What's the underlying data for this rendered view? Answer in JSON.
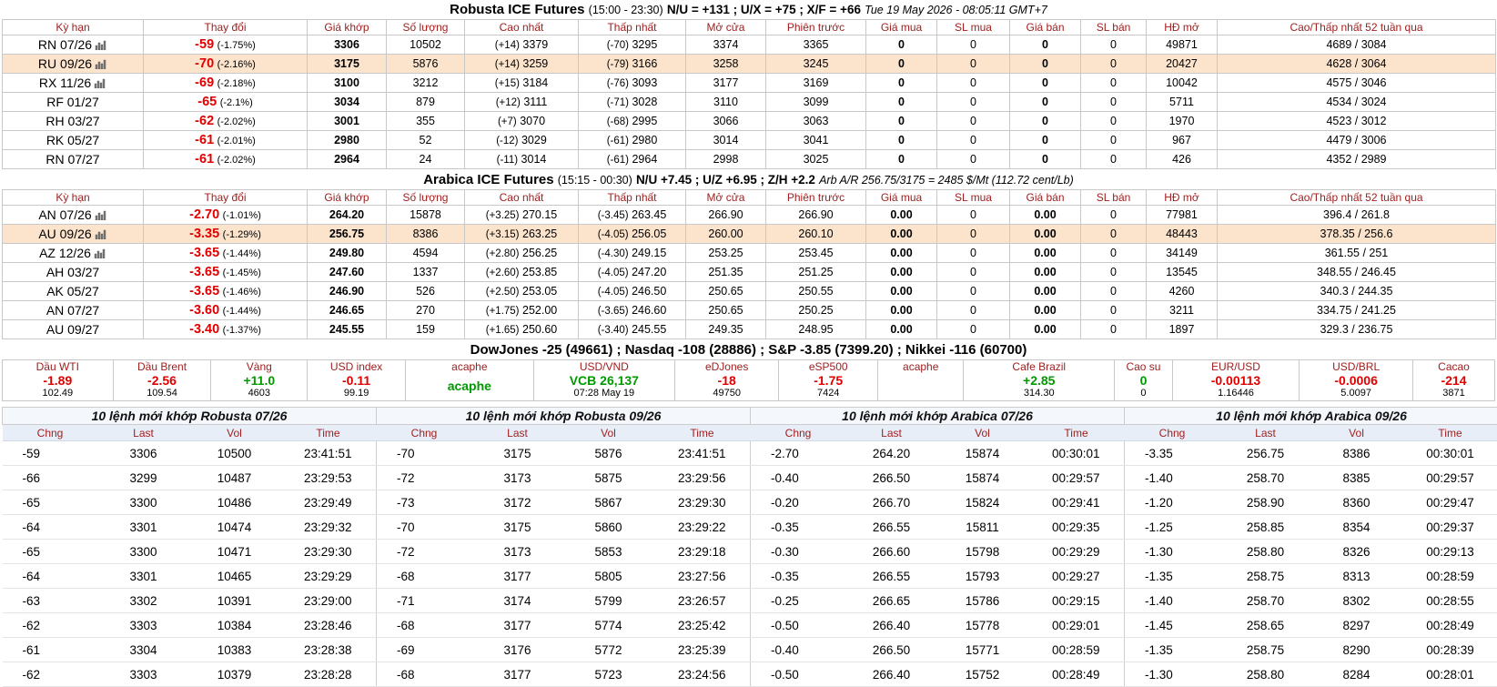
{
  "robusta": {
    "title": "Robusta ICE Futures",
    "hours": "(15:00 - 23:30)",
    "spreads": "N/U = +131 ; U/X = +75 ; X/F = +66",
    "timestamp": "Tue 19 May 2026 - 08:05:11 GMT+7",
    "headers": [
      "Kỳ hạn",
      "Thay đổi",
      "Giá khớp",
      "Số lượng",
      "Cao nhất",
      "Thấp nhất",
      "Mở cửa",
      "Phiên trước",
      "Giá mua",
      "SL mua",
      "Giá bán",
      "SL bán",
      "HĐ mở",
      "Cao/Thấp nhất 52 tuần qua"
    ],
    "rows": [
      {
        "sym": "RN 07/26",
        "chart": true,
        "hl": false,
        "chg": "-59",
        "pct": "(-1.75%)",
        "last": "3306",
        "vol": "10502",
        "high_d": "(+14)",
        "high": "3379",
        "low_d": "(-70)",
        "low": "3295",
        "open": "3374",
        "prev": "3365",
        "bid": "0",
        "bidq": "0",
        "ask": "0",
        "askq": "0",
        "oi": "49871",
        "range": "4689 / 3084"
      },
      {
        "sym": "RU 09/26",
        "chart": true,
        "hl": true,
        "chg": "-70",
        "pct": "(-2.16%)",
        "last": "3175",
        "vol": "5876",
        "high_d": "(+14)",
        "high": "3259",
        "low_d": "(-79)",
        "low": "3166",
        "open": "3258",
        "prev": "3245",
        "bid": "0",
        "bidq": "0",
        "ask": "0",
        "askq": "0",
        "oi": "20427",
        "range": "4628 / 3064"
      },
      {
        "sym": "RX 11/26",
        "chart": true,
        "hl": false,
        "chg": "-69",
        "pct": "(-2.18%)",
        "last": "3100",
        "vol": "3212",
        "high_d": "(+15)",
        "high": "3184",
        "low_d": "(-76)",
        "low": "3093",
        "open": "3177",
        "prev": "3169",
        "bid": "0",
        "bidq": "0",
        "ask": "0",
        "askq": "0",
        "oi": "10042",
        "range": "4575 / 3046"
      },
      {
        "sym": "RF 01/27",
        "chart": false,
        "hl": false,
        "chg": "-65",
        "pct": "(-2.1%)",
        "last": "3034",
        "vol": "879",
        "high_d": "(+12)",
        "high": "3111",
        "low_d": "(-71)",
        "low": "3028",
        "open": "3110",
        "prev": "3099",
        "bid": "0",
        "bidq": "0",
        "ask": "0",
        "askq": "0",
        "oi": "5711",
        "range": "4534 / 3024"
      },
      {
        "sym": "RH 03/27",
        "chart": false,
        "hl": false,
        "chg": "-62",
        "pct": "(-2.02%)",
        "last": "3001",
        "vol": "355",
        "high_d": "(+7)",
        "high": "3070",
        "low_d": "(-68)",
        "low": "2995",
        "open": "3066",
        "prev": "3063",
        "bid": "0",
        "bidq": "0",
        "ask": "0",
        "askq": "0",
        "oi": "1970",
        "range": "4523 / 3012"
      },
      {
        "sym": "RK 05/27",
        "chart": false,
        "hl": false,
        "chg": "-61",
        "pct": "(-2.01%)",
        "last": "2980",
        "vol": "52",
        "high_d": "(-12)",
        "high": "3029",
        "low_d": "(-61)",
        "low": "2980",
        "open": "3014",
        "prev": "3041",
        "bid": "0",
        "bidq": "0",
        "ask": "0",
        "askq": "0",
        "oi": "967",
        "range": "4479 / 3006"
      },
      {
        "sym": "RN 07/27",
        "chart": false,
        "hl": false,
        "chg": "-61",
        "pct": "(-2.02%)",
        "last": "2964",
        "vol": "24",
        "high_d": "(-11)",
        "high": "3014",
        "low_d": "(-61)",
        "low": "2964",
        "open": "2998",
        "prev": "3025",
        "bid": "0",
        "bidq": "0",
        "ask": "0",
        "askq": "0",
        "oi": "426",
        "range": "4352 / 2989"
      }
    ]
  },
  "arabica": {
    "title": "Arabica ICE Futures",
    "hours": "(15:15 - 00:30)",
    "spreads": "N/U +7.45 ; U/Z +6.95 ; Z/H +2.2",
    "arb": "Arb A/R 256.75/3175 = 2485 $/Mt (112.72 cent/Lb)",
    "headers": [
      "Kỳ hạn",
      "Thay đổi",
      "Giá khớp",
      "Số lượng",
      "Cao nhất",
      "Thấp nhất",
      "Mở cửa",
      "Phiên trước",
      "Giá mua",
      "SL mua",
      "Giá bán",
      "SL bán",
      "HĐ mở",
      "Cao/Thấp nhất 52 tuần qua"
    ],
    "rows": [
      {
        "sym": "AN 07/26",
        "chart": true,
        "hl": false,
        "chg": "-2.70",
        "pct": "(-1.01%)",
        "last": "264.20",
        "vol": "15878",
        "high_d": "(+3.25)",
        "high": "270.15",
        "low_d": "(-3.45)",
        "low": "263.45",
        "open": "266.90",
        "prev": "266.90",
        "bid": "0.00",
        "bidq": "0",
        "ask": "0.00",
        "askq": "0",
        "oi": "77981",
        "range": "396.4 / 261.8"
      },
      {
        "sym": "AU 09/26",
        "chart": true,
        "hl": true,
        "chg": "-3.35",
        "pct": "(-1.29%)",
        "last": "256.75",
        "vol": "8386",
        "high_d": "(+3.15)",
        "high": "263.25",
        "low_d": "(-4.05)",
        "low": "256.05",
        "open": "260.00",
        "prev": "260.10",
        "bid": "0.00",
        "bidq": "0",
        "ask": "0.00",
        "askq": "0",
        "oi": "48443",
        "range": "378.35 / 256.6"
      },
      {
        "sym": "AZ 12/26",
        "chart": true,
        "hl": false,
        "chg": "-3.65",
        "pct": "(-1.44%)",
        "last": "249.80",
        "vol": "4594",
        "high_d": "(+2.80)",
        "high": "256.25",
        "low_d": "(-4.30)",
        "low": "249.15",
        "open": "253.25",
        "prev": "253.45",
        "bid": "0.00",
        "bidq": "0",
        "ask": "0.00",
        "askq": "0",
        "oi": "34149",
        "range": "361.55 / 251"
      },
      {
        "sym": "AH 03/27",
        "chart": false,
        "hl": false,
        "chg": "-3.65",
        "pct": "(-1.45%)",
        "last": "247.60",
        "vol": "1337",
        "high_d": "(+2.60)",
        "high": "253.85",
        "low_d": "(-4.05)",
        "low": "247.20",
        "open": "251.35",
        "prev": "251.25",
        "bid": "0.00",
        "bidq": "0",
        "ask": "0.00",
        "askq": "0",
        "oi": "13545",
        "range": "348.55 / 246.45"
      },
      {
        "sym": "AK 05/27",
        "chart": false,
        "hl": false,
        "chg": "-3.65",
        "pct": "(-1.46%)",
        "last": "246.90",
        "vol": "526",
        "high_d": "(+2.50)",
        "high": "253.05",
        "low_d": "(-4.05)",
        "low": "246.50",
        "open": "250.65",
        "prev": "250.55",
        "bid": "0.00",
        "bidq": "0",
        "ask": "0.00",
        "askq": "0",
        "oi": "4260",
        "range": "340.3 / 244.35"
      },
      {
        "sym": "AN 07/27",
        "chart": false,
        "hl": false,
        "chg": "-3.60",
        "pct": "(-1.44%)",
        "last": "246.65",
        "vol": "270",
        "high_d": "(+1.75)",
        "high": "252.00",
        "low_d": "(-3.65)",
        "low": "246.60",
        "open": "250.65",
        "prev": "250.25",
        "bid": "0.00",
        "bidq": "0",
        "ask": "0.00",
        "askq": "0",
        "oi": "3211",
        "range": "334.75 / 241.25"
      },
      {
        "sym": "AU 09/27",
        "chart": false,
        "hl": false,
        "chg": "-3.40",
        "pct": "(-1.37%)",
        "last": "245.55",
        "vol": "159",
        "high_d": "(+1.65)",
        "high": "250.60",
        "low_d": "(-3.40)",
        "low": "245.55",
        "open": "249.35",
        "prev": "248.95",
        "bid": "0.00",
        "bidq": "0",
        "ask": "0.00",
        "askq": "0",
        "oi": "1897",
        "range": "329.3 / 236.75"
      }
    ]
  },
  "indices_line": "DowJones -25 (49661) ; Nasdaq -108 (28886) ; S&P -3.85 (7399.20) ; Nikkei -116 (60700)",
  "markets": [
    {
      "label": "Dầu WTI",
      "value": "-1.89",
      "sub": "102.49",
      "color": "red"
    },
    {
      "label": "Dầu Brent",
      "value": "-2.56",
      "sub": "109.54",
      "color": "red"
    },
    {
      "label": "Vàng",
      "value": "+11.0",
      "sub": "4603",
      "color": "green"
    },
    {
      "label": "USD index",
      "value": "-0.11",
      "sub": "99.19",
      "color": "red"
    },
    {
      "label": "acaphe",
      "value": "acaphe",
      "sub": "",
      "color": "green",
      "mid": true
    },
    {
      "label": "USD/VND",
      "value": "VCB 26,137",
      "sub": "07:28 May 19",
      "color": "green"
    },
    {
      "label": "eDJones",
      "value": "-18",
      "sub": "49750",
      "color": "red"
    },
    {
      "label": "eSP500",
      "value": "-1.75",
      "sub": "7424",
      "color": "red"
    },
    {
      "label": "acaphe",
      "value": "",
      "sub": "",
      "color": "green"
    },
    {
      "label": "Cafe Brazil",
      "value": "+2.85",
      "sub": "314.30",
      "color": "green"
    },
    {
      "label": "Cao su",
      "value": "0",
      "sub": "0",
      "color": "green"
    },
    {
      "label": "EUR/USD",
      "value": "-0.00113",
      "sub": "1.16446",
      "color": "red"
    },
    {
      "label": "USD/BRL",
      "value": "-0.0006",
      "sub": "5.0097",
      "color": "red"
    },
    {
      "label": "Cacao",
      "value": "-214",
      "sub": "3871",
      "color": "red"
    }
  ],
  "trades": {
    "headers": [
      "Chng",
      "Last",
      "Vol",
      "Time"
    ],
    "panels": [
      {
        "title": "10 lệnh mới khớp Robusta 07/26",
        "rows": [
          [
            "-59",
            "3306",
            "10500",
            "23:41:51"
          ],
          [
            "-66",
            "3299",
            "10487",
            "23:29:53"
          ],
          [
            "-65",
            "3300",
            "10486",
            "23:29:49"
          ],
          [
            "-64",
            "3301",
            "10474",
            "23:29:32"
          ],
          [
            "-65",
            "3300",
            "10471",
            "23:29:30"
          ],
          [
            "-64",
            "3301",
            "10465",
            "23:29:29"
          ],
          [
            "-63",
            "3302",
            "10391",
            "23:29:00"
          ],
          [
            "-62",
            "3303",
            "10384",
            "23:28:46"
          ],
          [
            "-61",
            "3304",
            "10383",
            "23:28:38"
          ],
          [
            "-62",
            "3303",
            "10379",
            "23:28:28"
          ]
        ]
      },
      {
        "title": "10 lệnh mới khớp Robusta 09/26",
        "rows": [
          [
            "-70",
            "3175",
            "5876",
            "23:41:51"
          ],
          [
            "-72",
            "3173",
            "5875",
            "23:29:56"
          ],
          [
            "-73",
            "3172",
            "5867",
            "23:29:30"
          ],
          [
            "-70",
            "3175",
            "5860",
            "23:29:22"
          ],
          [
            "-72",
            "3173",
            "5853",
            "23:29:18"
          ],
          [
            "-68",
            "3177",
            "5805",
            "23:27:56"
          ],
          [
            "-71",
            "3174",
            "5799",
            "23:26:57"
          ],
          [
            "-68",
            "3177",
            "5774",
            "23:25:42"
          ],
          [
            "-69",
            "3176",
            "5772",
            "23:25:39"
          ],
          [
            "-68",
            "3177",
            "5723",
            "23:24:56"
          ]
        ]
      },
      {
        "title": "10 lệnh mới khớp Arabica 07/26",
        "rows": [
          [
            "-2.70",
            "264.20",
            "15874",
            "00:30:01"
          ],
          [
            "-0.40",
            "266.50",
            "15874",
            "00:29:57"
          ],
          [
            "-0.20",
            "266.70",
            "15824",
            "00:29:41"
          ],
          [
            "-0.35",
            "266.55",
            "15811",
            "00:29:35"
          ],
          [
            "-0.30",
            "266.60",
            "15798",
            "00:29:29"
          ],
          [
            "-0.35",
            "266.55",
            "15793",
            "00:29:27"
          ],
          [
            "-0.25",
            "266.65",
            "15786",
            "00:29:15"
          ],
          [
            "-0.50",
            "266.40",
            "15778",
            "00:29:01"
          ],
          [
            "-0.40",
            "266.50",
            "15771",
            "00:28:59"
          ],
          [
            "-0.50",
            "266.40",
            "15752",
            "00:28:49"
          ]
        ]
      },
      {
        "title": "10 lệnh mới khớp Arabica 09/26",
        "rows": [
          [
            "-3.35",
            "256.75",
            "8386",
            "00:30:01"
          ],
          [
            "-1.40",
            "258.70",
            "8385",
            "00:29:57"
          ],
          [
            "-1.20",
            "258.90",
            "8360",
            "00:29:47"
          ],
          [
            "-1.25",
            "258.85",
            "8354",
            "00:29:37"
          ],
          [
            "-1.30",
            "258.80",
            "8326",
            "00:29:13"
          ],
          [
            "-1.35",
            "258.75",
            "8313",
            "00:28:59"
          ],
          [
            "-1.40",
            "258.70",
            "8302",
            "00:28:55"
          ],
          [
            "-1.45",
            "258.65",
            "8297",
            "00:28:49"
          ],
          [
            "-1.35",
            "258.75",
            "8290",
            "00:28:39"
          ],
          [
            "-1.30",
            "258.80",
            "8284",
            "00:28:01"
          ]
        ]
      }
    ]
  },
  "colors": {
    "negative": "#e00000",
    "positive": "#009900",
    "highlight_row": "#fbe3cc",
    "header_text": "#a02020"
  }
}
